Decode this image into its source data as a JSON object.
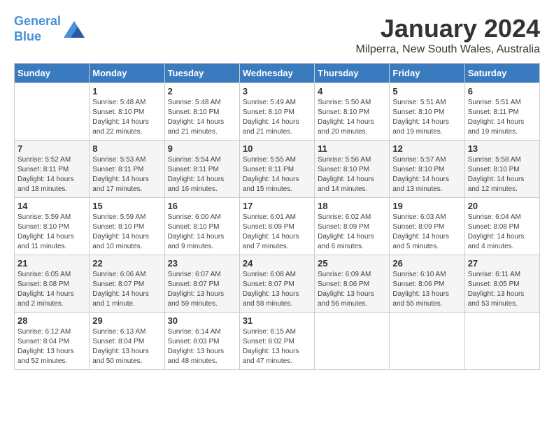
{
  "header": {
    "logo_line1": "General",
    "logo_line2": "Blue",
    "month": "January 2024",
    "location": "Milperra, New South Wales, Australia"
  },
  "weekdays": [
    "Sunday",
    "Monday",
    "Tuesday",
    "Wednesday",
    "Thursday",
    "Friday",
    "Saturday"
  ],
  "weeks": [
    [
      {
        "day": "",
        "info": ""
      },
      {
        "day": "1",
        "info": "Sunrise: 5:48 AM\nSunset: 8:10 PM\nDaylight: 14 hours\nand 22 minutes."
      },
      {
        "day": "2",
        "info": "Sunrise: 5:48 AM\nSunset: 8:10 PM\nDaylight: 14 hours\nand 21 minutes."
      },
      {
        "day": "3",
        "info": "Sunrise: 5:49 AM\nSunset: 8:10 PM\nDaylight: 14 hours\nand 21 minutes."
      },
      {
        "day": "4",
        "info": "Sunrise: 5:50 AM\nSunset: 8:10 PM\nDaylight: 14 hours\nand 20 minutes."
      },
      {
        "day": "5",
        "info": "Sunrise: 5:51 AM\nSunset: 8:10 PM\nDaylight: 14 hours\nand 19 minutes."
      },
      {
        "day": "6",
        "info": "Sunrise: 5:51 AM\nSunset: 8:11 PM\nDaylight: 14 hours\nand 19 minutes."
      }
    ],
    [
      {
        "day": "7",
        "info": "Sunrise: 5:52 AM\nSunset: 8:11 PM\nDaylight: 14 hours\nand 18 minutes."
      },
      {
        "day": "8",
        "info": "Sunrise: 5:53 AM\nSunset: 8:11 PM\nDaylight: 14 hours\nand 17 minutes."
      },
      {
        "day": "9",
        "info": "Sunrise: 5:54 AM\nSunset: 8:11 PM\nDaylight: 14 hours\nand 16 minutes."
      },
      {
        "day": "10",
        "info": "Sunrise: 5:55 AM\nSunset: 8:11 PM\nDaylight: 14 hours\nand 15 minutes."
      },
      {
        "day": "11",
        "info": "Sunrise: 5:56 AM\nSunset: 8:10 PM\nDaylight: 14 hours\nand 14 minutes."
      },
      {
        "day": "12",
        "info": "Sunrise: 5:57 AM\nSunset: 8:10 PM\nDaylight: 14 hours\nand 13 minutes."
      },
      {
        "day": "13",
        "info": "Sunrise: 5:58 AM\nSunset: 8:10 PM\nDaylight: 14 hours\nand 12 minutes."
      }
    ],
    [
      {
        "day": "14",
        "info": "Sunrise: 5:59 AM\nSunset: 8:10 PM\nDaylight: 14 hours\nand 11 minutes."
      },
      {
        "day": "15",
        "info": "Sunrise: 5:59 AM\nSunset: 8:10 PM\nDaylight: 14 hours\nand 10 minutes."
      },
      {
        "day": "16",
        "info": "Sunrise: 6:00 AM\nSunset: 8:10 PM\nDaylight: 14 hours\nand 9 minutes."
      },
      {
        "day": "17",
        "info": "Sunrise: 6:01 AM\nSunset: 8:09 PM\nDaylight: 14 hours\nand 7 minutes."
      },
      {
        "day": "18",
        "info": "Sunrise: 6:02 AM\nSunset: 8:09 PM\nDaylight: 14 hours\nand 6 minutes."
      },
      {
        "day": "19",
        "info": "Sunrise: 6:03 AM\nSunset: 8:09 PM\nDaylight: 14 hours\nand 5 minutes."
      },
      {
        "day": "20",
        "info": "Sunrise: 6:04 AM\nSunset: 8:08 PM\nDaylight: 14 hours\nand 4 minutes."
      }
    ],
    [
      {
        "day": "21",
        "info": "Sunrise: 6:05 AM\nSunset: 8:08 PM\nDaylight: 14 hours\nand 2 minutes."
      },
      {
        "day": "22",
        "info": "Sunrise: 6:06 AM\nSunset: 8:07 PM\nDaylight: 14 hours\nand 1 minute."
      },
      {
        "day": "23",
        "info": "Sunrise: 6:07 AM\nSunset: 8:07 PM\nDaylight: 13 hours\nand 59 minutes."
      },
      {
        "day": "24",
        "info": "Sunrise: 6:08 AM\nSunset: 8:07 PM\nDaylight: 13 hours\nand 58 minutes."
      },
      {
        "day": "25",
        "info": "Sunrise: 6:09 AM\nSunset: 8:06 PM\nDaylight: 13 hours\nand 56 minutes."
      },
      {
        "day": "26",
        "info": "Sunrise: 6:10 AM\nSunset: 8:06 PM\nDaylight: 13 hours\nand 55 minutes."
      },
      {
        "day": "27",
        "info": "Sunrise: 6:11 AM\nSunset: 8:05 PM\nDaylight: 13 hours\nand 53 minutes."
      }
    ],
    [
      {
        "day": "28",
        "info": "Sunrise: 6:12 AM\nSunset: 8:04 PM\nDaylight: 13 hours\nand 52 minutes."
      },
      {
        "day": "29",
        "info": "Sunrise: 6:13 AM\nSunset: 8:04 PM\nDaylight: 13 hours\nand 50 minutes."
      },
      {
        "day": "30",
        "info": "Sunrise: 6:14 AM\nSunset: 8:03 PM\nDaylight: 13 hours\nand 48 minutes."
      },
      {
        "day": "31",
        "info": "Sunrise: 6:15 AM\nSunset: 8:02 PM\nDaylight: 13 hours\nand 47 minutes."
      },
      {
        "day": "",
        "info": ""
      },
      {
        "day": "",
        "info": ""
      },
      {
        "day": "",
        "info": ""
      }
    ]
  ]
}
